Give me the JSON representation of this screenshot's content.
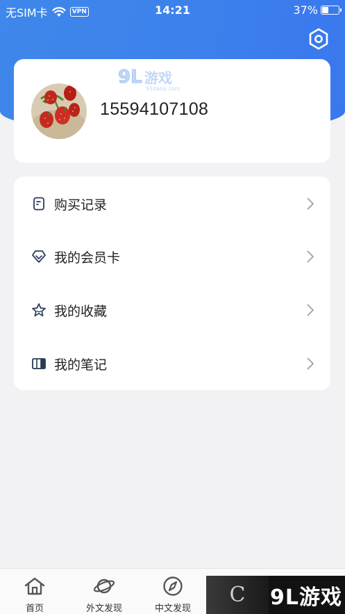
{
  "status_bar": {
    "carrier": "无SIM卡",
    "vpn": "VPN",
    "time": "14:21",
    "battery_percent": "37%",
    "battery_level": 0.37
  },
  "header": {
    "settings_icon": "settings-hexagon-icon",
    "watermark": "91游戏",
    "watermark_sub": "91danji.com"
  },
  "profile": {
    "phone": "15594107108",
    "avatar": "strawberry-photo"
  },
  "menu": {
    "items": [
      {
        "label": "购买记录",
        "icon": "receipt-icon"
      },
      {
        "label": "我的会员卡",
        "icon": "diamond-icon"
      },
      {
        "label": "我的收藏",
        "icon": "star-icon"
      },
      {
        "label": "我的笔记",
        "icon": "notebook-icon"
      }
    ]
  },
  "tabbar": {
    "tabs": [
      {
        "label": "首页",
        "icon": "home-icon"
      },
      {
        "label": "外文发现",
        "icon": "planet-icon"
      },
      {
        "label": "中文发现",
        "icon": "compass-icon"
      }
    ]
  },
  "watermark_bottom": {
    "text": "9L游戏"
  },
  "colors": {
    "header_blue": "#3d82ec",
    "background": "#f2f2f4",
    "card": "#ffffff",
    "icon_dark": "#2a3a55"
  }
}
